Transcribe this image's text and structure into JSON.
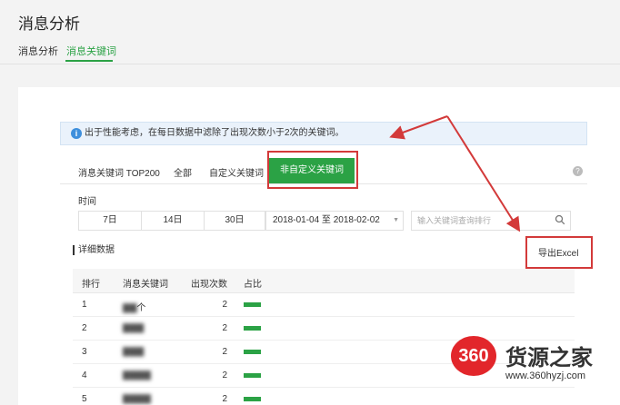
{
  "page": {
    "title": "消息分析"
  },
  "top_tabs": [
    {
      "label": "消息分析",
      "active": false
    },
    {
      "label": "消息关键词",
      "active": true
    }
  ],
  "notice": {
    "icon": "info-icon",
    "text": "出于性能考虑，在每日数据中滤除了出现次数小于2次的关键词。"
  },
  "subtabs": [
    {
      "label": "消息关键词 TOP200",
      "active": false
    },
    {
      "label": "全部",
      "active": false
    },
    {
      "label": "自定义关键词",
      "active": false
    },
    {
      "label": "非自定义关键词",
      "active": true
    }
  ],
  "filters": {
    "time_label": "时间",
    "ranges": [
      "7日",
      "14日",
      "30日"
    ],
    "date_range": "2018-01-04 至 2018-02-02",
    "search_placeholder": "输入关键词查询排行"
  },
  "detail": {
    "title": "详细数据",
    "export_label": "导出Excel",
    "columns": [
      "排行",
      "消息关键词",
      "出现次数",
      "占比"
    ],
    "rows": [
      {
        "rank": "1",
        "keyword": "个",
        "count": "2"
      },
      {
        "rank": "2",
        "keyword": "",
        "count": "2"
      },
      {
        "rank": "3",
        "keyword": "",
        "count": "2"
      },
      {
        "rank": "4",
        "keyword": "",
        "count": "2"
      },
      {
        "rank": "5",
        "keyword": "",
        "count": "2"
      }
    ]
  },
  "watermark": {
    "logo": "360",
    "name": "货源之家",
    "url": "www.360hyzj.com"
  },
  "colors": {
    "accent": "#2ba245",
    "annotation": "#d33a3a",
    "info": "#3e8fdc"
  }
}
